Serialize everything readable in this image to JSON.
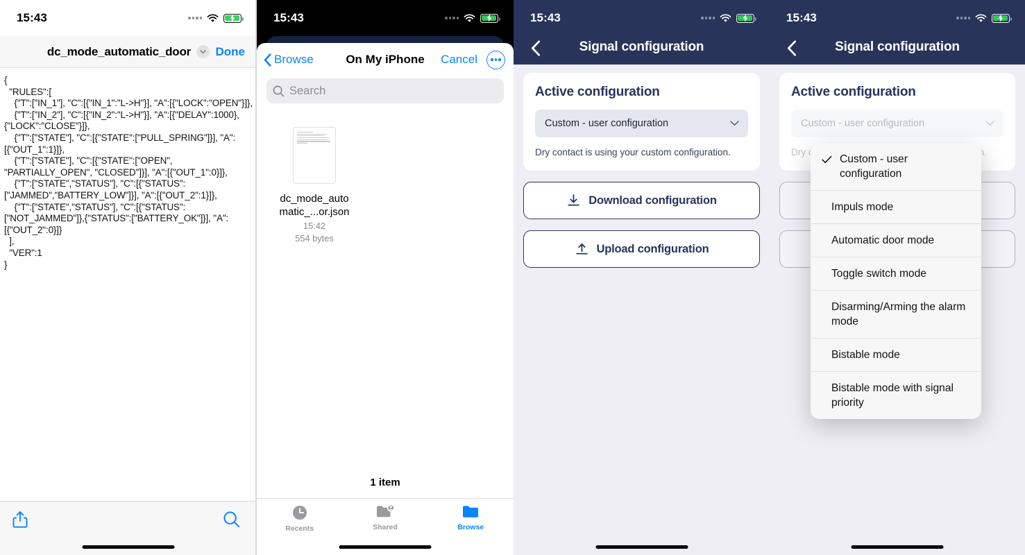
{
  "status_bar": {
    "time": "15:43",
    "signal_icon": "signal-dots-icon",
    "wifi_icon": "wifi-icon",
    "battery_icon": "battery-charging-icon"
  },
  "panel1": {
    "name": "json-file-preview",
    "title": "dc_mode_automatic_door",
    "done_label": "Done",
    "chevron_icon": "chevron-down-icon",
    "share_icon": "share-icon",
    "search_icon": "search-icon",
    "code": "{\n  \"RULES\":[\n    {\"T\":[\"IN_1\"], \"C\":[{\"IN_1\":\"L->H\"}], \"A\":[{\"LOCK\":\"OPEN\"}]},\n    {\"T\":[\"IN_2\"], \"C\":[{\"IN_2\":\"L->H\"}], \"A\":[{\"DELAY\":1000},{\"LOCK\":\"CLOSE\"}]},\n    {\"T\":[\"STATE\"], \"C\":[{\"STATE\":[\"PULL_SPRING\"]}], \"A\":[{\"OUT_1\":1}]},\n    {\"T\":[\"STATE\"], \"C\":[{\"STATE\":[\"OPEN\", \"PARTIALLY_OPEN\", \"CLOSED\"]}], \"A\":[{\"OUT_1\":0}]},\n    {\"T\":[\"STATE\",\"STATUS\"], \"C\":[{\"STATUS\":[\"JAMMED\",\"BATTERY_LOW\"]}], \"A\":[{\"OUT_2\":1}]},\n    {\"T\":[\"STATE\",\"STATUS\"], \"C\":[{\"STATUS\":[\"NOT_JAMMED\"]},{\"STATUS\":[\"BATTERY_OK\"]}], \"A\":[{\"OUT_2\":0}]}\n  ],\n  \"VER\":1\n}"
  },
  "panel2": {
    "name": "files-picker-sheet",
    "back_label": "Browse",
    "title": "On My iPhone",
    "cancel_label": "Cancel",
    "more_icon": "more-circle-icon",
    "search_placeholder": "Search",
    "search_icon": "search-icon",
    "file": {
      "name": "dc_mode_automatic_...or.json",
      "name_line1": "dc_mode_auto",
      "name_line2": "matic_...or.json",
      "time": "15:42",
      "size": "554 bytes",
      "thumbnail_icon": "document-thumbnail-icon"
    },
    "item_count": "1 item",
    "tabs": [
      {
        "label": "Recents",
        "icon": "clock-icon",
        "active": false
      },
      {
        "label": "Shared",
        "icon": "shared-folder-icon",
        "active": false
      },
      {
        "label": "Browse",
        "icon": "folder-icon",
        "active": true
      }
    ]
  },
  "panel3": {
    "name": "signal-configuration-screen",
    "back_icon": "chevron-left-icon",
    "title": "Signal configuration",
    "card_title": "Active configuration",
    "select_value": "Custom - user configuration",
    "select_icon": "chevron-down-icon",
    "hint": "Dry contact is using your custom configuration.",
    "download_label": "Download configuration",
    "download_icon": "download-icon",
    "upload_label": "Upload configuration",
    "upload_icon": "upload-icon"
  },
  "panel4": {
    "name": "signal-configuration-screen-with-dropdown",
    "back_icon": "chevron-left-icon",
    "title": "Signal configuration",
    "card_title": "Active configuration",
    "select_value": "Custom - user configuration",
    "select_icon": "chevron-down-icon",
    "hint": "Dry contact is using your custom configuration.",
    "dropdown": {
      "check_icon": "checkmark-icon",
      "options": [
        {
          "label": "Custom - user configuration",
          "selected": true
        },
        {
          "label": "Impuls mode",
          "selected": false
        },
        {
          "label": "Automatic door mode",
          "selected": false
        },
        {
          "label": "Toggle switch mode",
          "selected": false
        },
        {
          "label": "Disarming/Arming the alarm mode",
          "selected": false
        },
        {
          "label": "Bistable mode",
          "selected": false
        },
        {
          "label": "Bistable mode with signal priority",
          "selected": false
        }
      ]
    }
  },
  "colors": {
    "brand_navy": "#29345b",
    "ios_blue": "#0a84ff",
    "battery_green": "#31d158",
    "app_background": "#eeeef4",
    "select_background": "#e4e7ef"
  }
}
